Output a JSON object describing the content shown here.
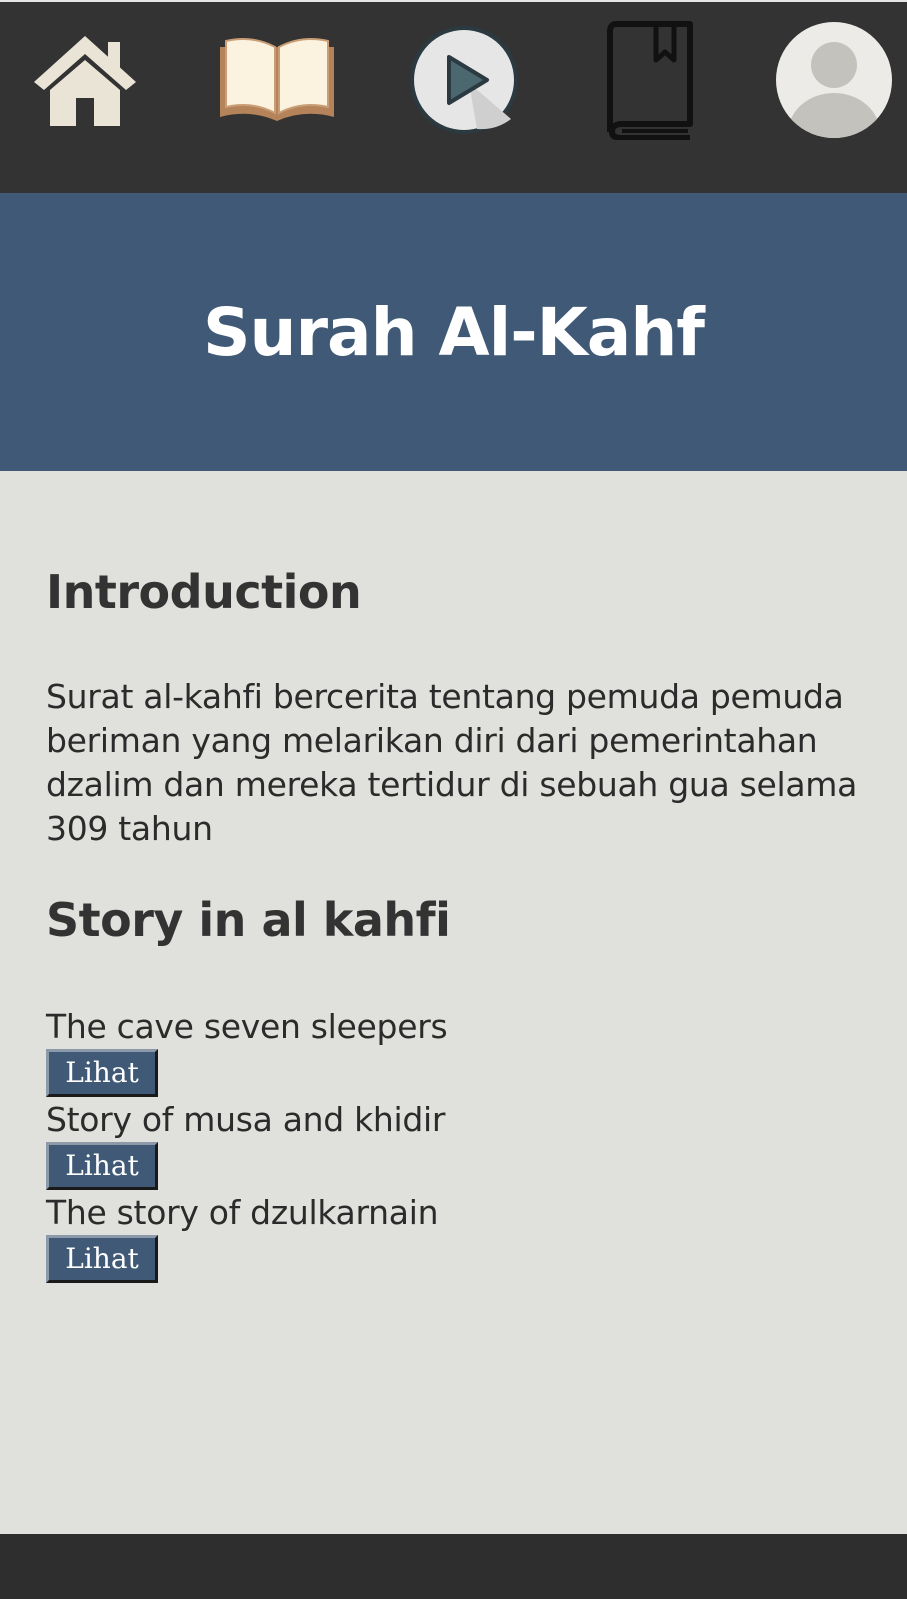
{
  "nav": {
    "items": [
      {
        "icon": "home-icon"
      },
      {
        "icon": "open-book-icon"
      },
      {
        "icon": "play-icon"
      },
      {
        "icon": "bookmark-book-icon"
      },
      {
        "icon": "user-avatar-icon"
      }
    ]
  },
  "hero": {
    "title": "Surah Al-Kahf"
  },
  "intro": {
    "heading": "Introduction",
    "text": "Surat al-kahfi bercerita tentang pemuda pemuda beriman yang melarikan diri dari pemerintahan dzalim dan mereka tertidur di sebuah gua selama 309 tahun"
  },
  "stories": {
    "heading": "Story in al kahfi",
    "items": [
      {
        "name": "The cave seven sleepers",
        "button": "Lihat"
      },
      {
        "name": "Story of musa and khidir",
        "button": "Lihat"
      },
      {
        "name": "The story of dzulkarnain",
        "button": "Lihat"
      }
    ]
  },
  "colors": {
    "navbar": "#333333",
    "hero": "#3f5976",
    "content_bg": "#e0e0dd",
    "text": "#333333"
  }
}
